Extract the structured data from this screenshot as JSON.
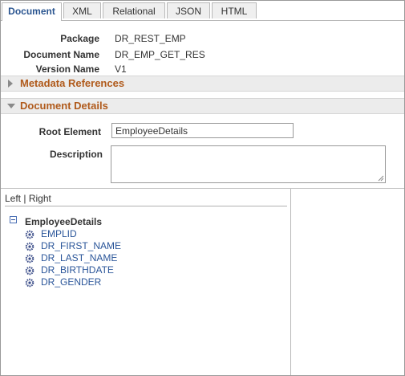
{
  "tabs": [
    {
      "label": "Document",
      "active": true
    },
    {
      "label": "XML",
      "active": false
    },
    {
      "label": "Relational",
      "active": false
    },
    {
      "label": "JSON",
      "active": false
    },
    {
      "label": "HTML",
      "active": false
    }
  ],
  "doc_info": {
    "package_label": "Package",
    "package_value": "DR_REST_EMP",
    "document_name_label": "Document Name",
    "document_name_value": "DR_EMP_GET_RES",
    "version_name_label": "Version Name",
    "version_name_value": "V1"
  },
  "sections": {
    "metadata_title": "Metadata References",
    "details_title": "Document Details"
  },
  "details": {
    "root_element_label": "Root Element",
    "root_element_value": "EmployeeDetails",
    "description_label": "Description",
    "description_value": ""
  },
  "tree": {
    "left_link": "Left",
    "separator": "|",
    "right_link": "Right",
    "root": "EmployeeDetails",
    "children": [
      "EMPLID",
      "DR_FIRST_NAME",
      "DR_LAST_NAME",
      "DR_BIRTHDATE",
      "DR_GENDER"
    ]
  },
  "colors": {
    "section_title": "#b05a1b",
    "link": "#2a5599",
    "active_tab_text": "#2a5590"
  },
  "icons": {
    "metadata_toggle": "triangle-right-icon",
    "details_toggle": "triangle-down-icon",
    "tree_collapse": "minus-box-icon",
    "tree_child": "gear-icon"
  }
}
